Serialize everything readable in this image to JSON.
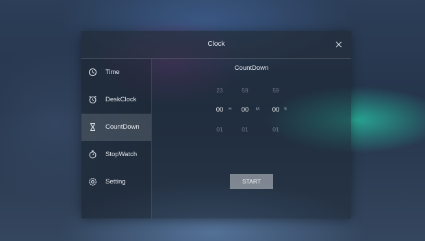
{
  "dialog": {
    "title": "Clock",
    "close_icon": "close-icon"
  },
  "sidebar": {
    "items": [
      {
        "label": "Time",
        "icon": "clock-icon",
        "active": false
      },
      {
        "label": "DeskClock",
        "icon": "alarm-clock-icon",
        "active": false
      },
      {
        "label": "CountDown",
        "icon": "hourglass-icon",
        "active": true
      },
      {
        "label": "StopWatch",
        "icon": "stopwatch-icon",
        "active": false
      },
      {
        "label": "Setting",
        "icon": "settings-icon",
        "active": false
      }
    ]
  },
  "countdown": {
    "title": "CountDown",
    "hours": {
      "prev": "23",
      "current": "00",
      "next": "01",
      "unit": "H"
    },
    "minutes": {
      "prev": "59",
      "current": "00",
      "next": "01",
      "unit": "M"
    },
    "seconds": {
      "prev": "59",
      "current": "00",
      "next": "01",
      "unit": "S"
    },
    "start_label": "START"
  }
}
